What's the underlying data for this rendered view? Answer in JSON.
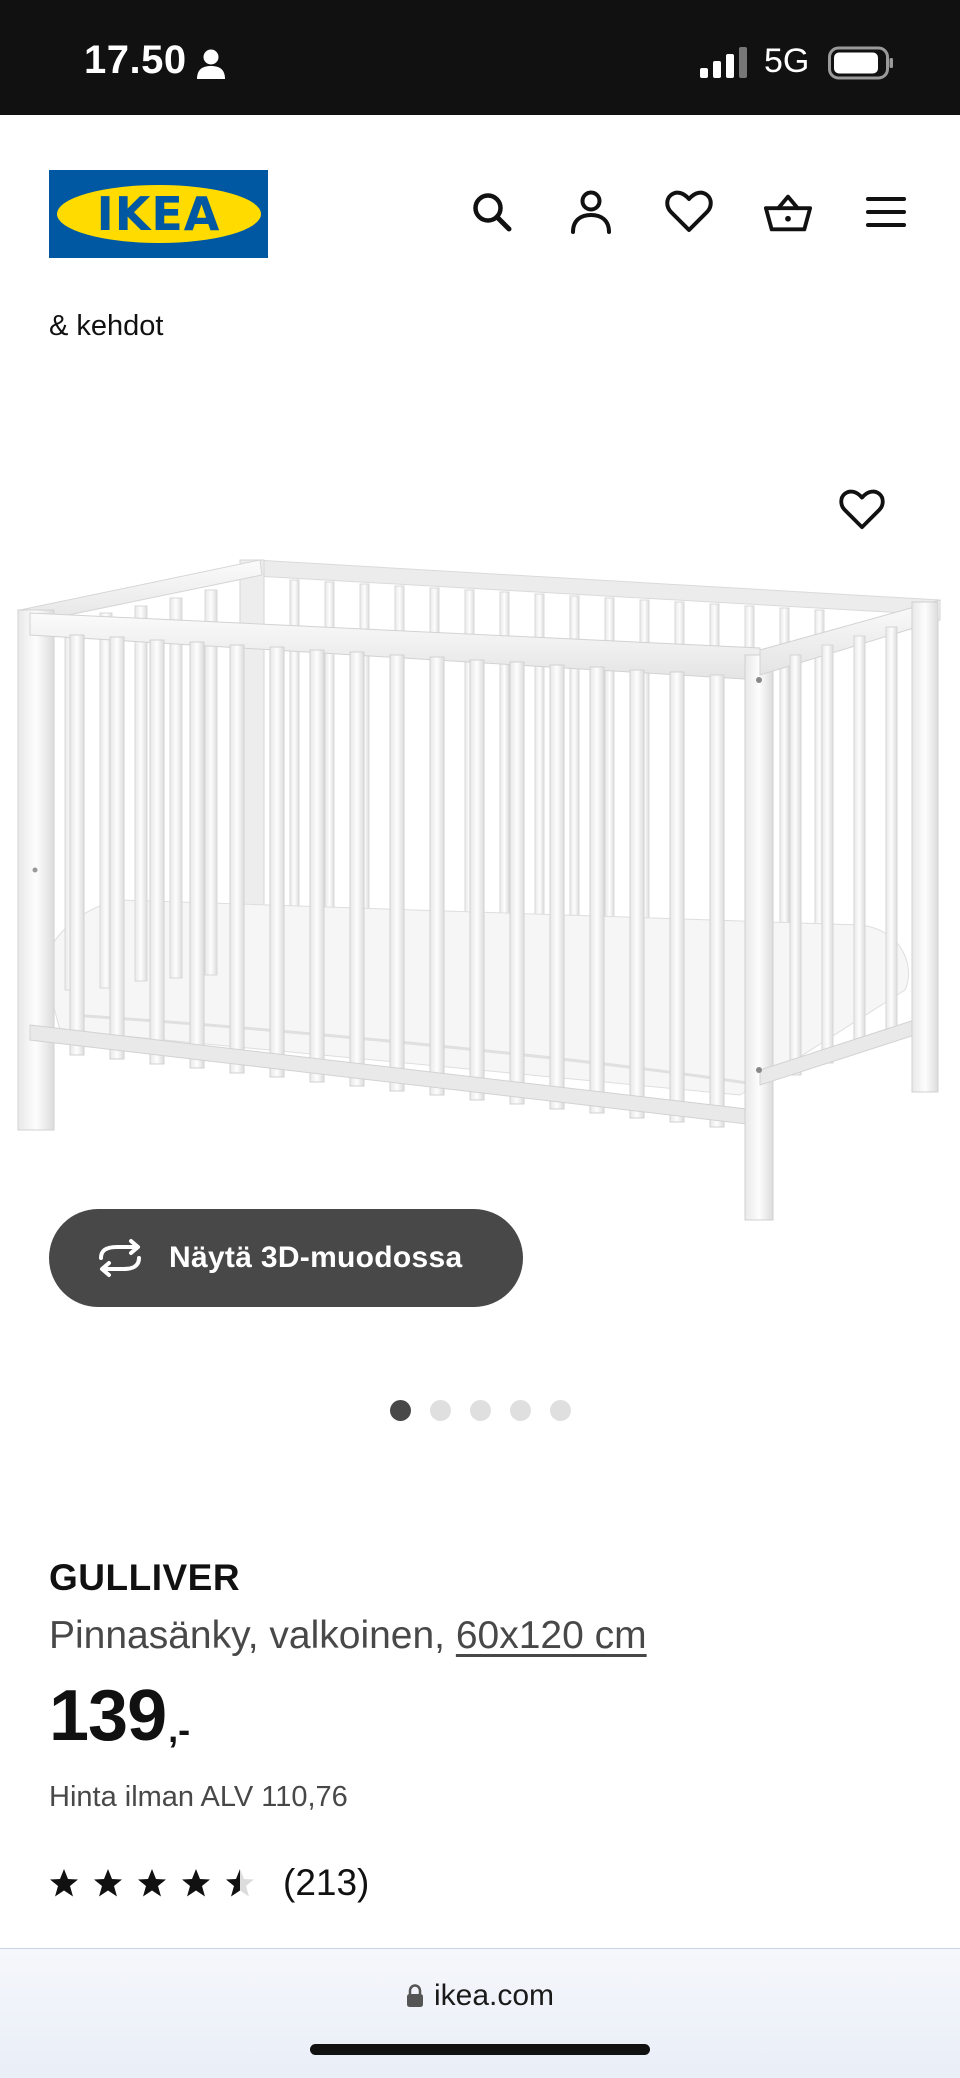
{
  "status_bar": {
    "time": "17.50",
    "network": "5G",
    "icons": [
      "person-icon",
      "signal-icon",
      "battery-icon"
    ]
  },
  "header": {
    "logo_text": "IKEA",
    "nav_icons": [
      "search-icon",
      "account-icon",
      "wishlist-icon",
      "cart-icon",
      "menu-icon"
    ]
  },
  "breadcrumb": "& kehdot",
  "product": {
    "view_3d_label": "Näytä 3D-muodossa",
    "carousel": {
      "total": 5,
      "active": 1
    },
    "name": "GULLIVER",
    "description": "Pinnasänky, valkoinen, ",
    "size": "60x120 cm",
    "price_integer": "139",
    "price_decimal": ",-",
    "price_ex_vat": "Hinta ilman ALV 110,76",
    "rating": 4.5,
    "review_count": "(213)"
  },
  "browser": {
    "url": "ikea.com"
  },
  "colors": {
    "ikea_blue": "#0058a3",
    "ikea_yellow": "#ffdb00",
    "button_dark": "#484848",
    "text_primary": "#111111"
  }
}
